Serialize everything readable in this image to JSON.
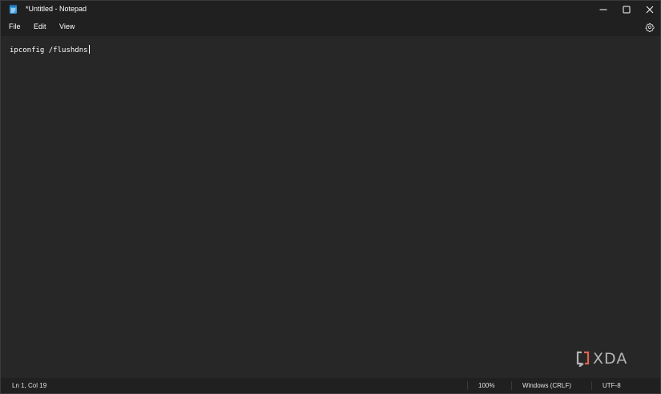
{
  "window": {
    "title": "*Untitled - Notepad",
    "icon": "notepad-icon"
  },
  "menu": {
    "file": "File",
    "edit": "Edit",
    "view": "View",
    "settings_icon": "gear-icon"
  },
  "editor": {
    "content": "ipconfig /flushdns"
  },
  "status": {
    "position": "Ln 1, Col 19",
    "zoom": "100%",
    "line_ending": "Windows (CRLF)",
    "encoding": "UTF-8"
  },
  "watermark": {
    "text": "XDA"
  },
  "colors": {
    "background": "#272727",
    "chrome": "#202020",
    "text": "#ffffff",
    "accent": "#4cc2ff"
  }
}
